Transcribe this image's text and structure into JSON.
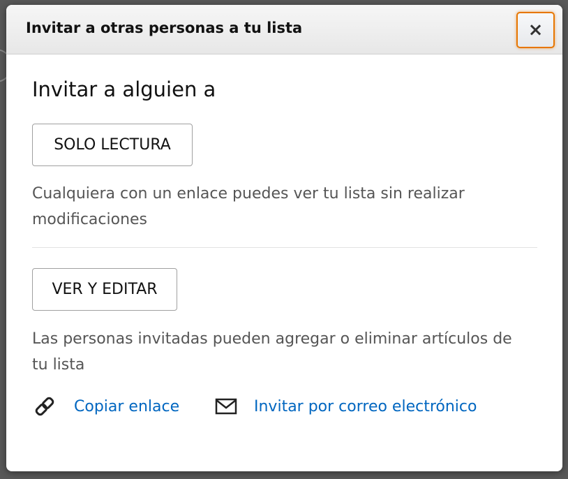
{
  "modal": {
    "title": "Invitar a otras personas a tu lista",
    "close_label": "×",
    "heading": "Invitar a alguien a",
    "read_only": {
      "button_label": "SOLO LECTURA",
      "description": "Cualquiera con un enlace puedes ver tu lista sin realizar modificaciones"
    },
    "view_edit": {
      "button_label": "VER Y EDITAR",
      "description": "Las personas invitadas pueden agregar o eliminar artículos de tu lista"
    },
    "actions": {
      "copy_link": {
        "label": "Copiar enlace",
        "icon": "link-icon"
      },
      "invite_email": {
        "label": "Invitar por correo electrónico",
        "icon": "envelope-icon"
      }
    }
  },
  "colors": {
    "link": "#0066c0",
    "close_focus_border": "#e77600"
  }
}
